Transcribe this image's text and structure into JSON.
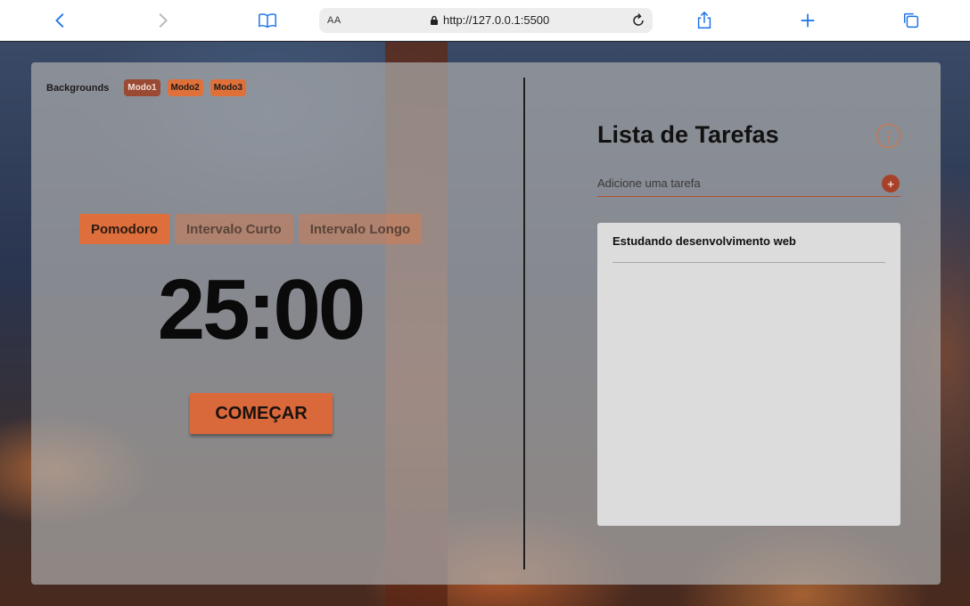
{
  "browser": {
    "text_size_label": "AA",
    "url": "http://127.0.0.1:5500"
  },
  "backgrounds": {
    "label": "Backgrounds",
    "modes": [
      "Modo1",
      "Modo2",
      "Modo3"
    ],
    "active_mode": "Modo1"
  },
  "timer": {
    "tabs": [
      "Pomodoro",
      "Intervalo Curto",
      "Intervalo Longo"
    ],
    "active_tab": "Pomodoro",
    "display": "25:00",
    "start_label": "COMEÇAR"
  },
  "todo": {
    "title": "Lista de Tarefas",
    "input_placeholder": "Adicione uma tarefa",
    "add_label": "+",
    "menu_label": "⋮",
    "items": [
      "Estudando desenvolvimento web"
    ]
  },
  "colors": {
    "accent": "#de6f3c",
    "accent_dark": "#9a4a33",
    "panel": "#aaaaaa",
    "list_bg": "#dcdcdc"
  }
}
